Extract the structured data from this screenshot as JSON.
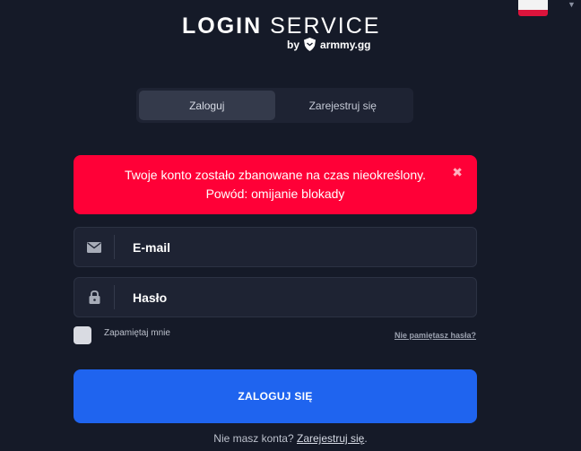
{
  "language": {
    "selected_flag": "poland-flag-icon"
  },
  "logo": {
    "title_bold": "LOGIN",
    "title_light": "SERVICE",
    "by": "by",
    "brand": "armmy.gg"
  },
  "tabs": [
    {
      "label": "Zaloguj",
      "active": true
    },
    {
      "label": "Zarejestruj się",
      "active": false
    }
  ],
  "alert": {
    "line1": "Twoje konto zostało zbanowane na czas nieokreślony.",
    "line2": "Powód: omijanie blokady",
    "close": "✖",
    "color": "#ff0037"
  },
  "form": {
    "email_placeholder": "E-mail",
    "password_placeholder": "Hasło",
    "remember_label": "Zapamiętaj mnie",
    "forgot_link": "Nie pamiętasz hasła?",
    "submit_label": "ZALOGUJ SIĘ"
  },
  "footer": {
    "text": "Nie masz konta?",
    "link": "Zarejestruj się",
    "end": "."
  },
  "colors": {
    "background": "#151a28",
    "accent": "#1f64ef"
  }
}
